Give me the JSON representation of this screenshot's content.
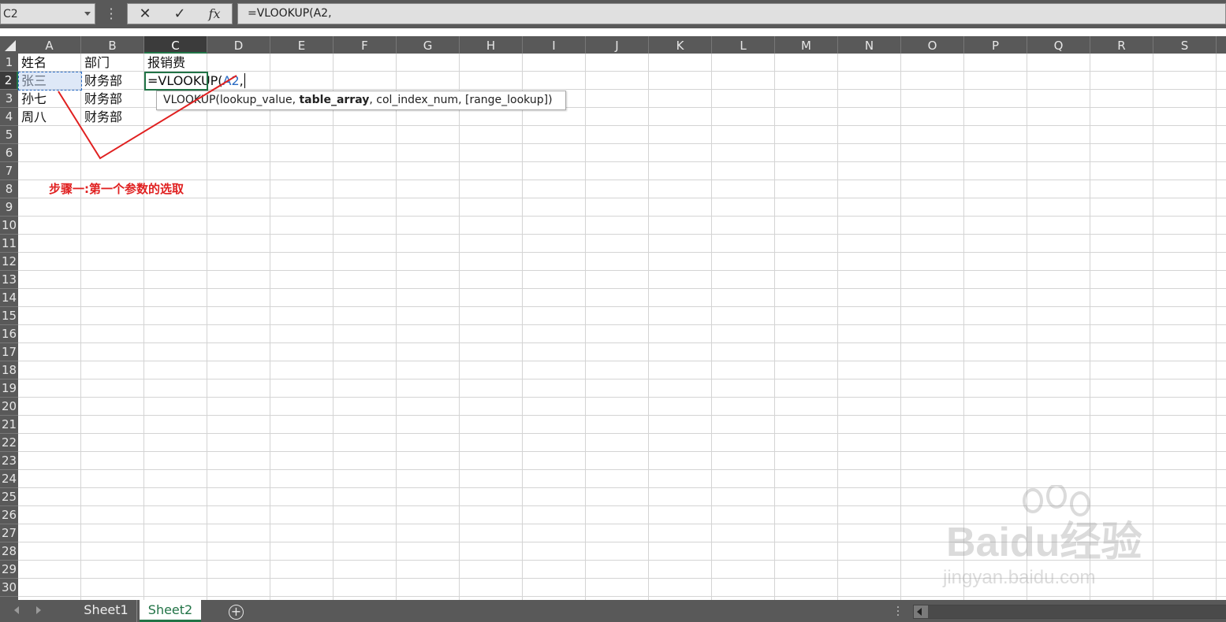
{
  "formula_bar": {
    "name_box": "C2",
    "cancel_glyph": "✕",
    "enter_glyph": "✓",
    "fx_label": "fx",
    "formula": "=VLOOKUP(A2,"
  },
  "columns": [
    "A",
    "B",
    "C",
    "D",
    "E",
    "F",
    "G",
    "H",
    "I",
    "J",
    "K",
    "L",
    "M",
    "N",
    "O",
    "P",
    "Q",
    "R",
    "S"
  ],
  "active_column": "C",
  "rows": [
    "1",
    "2",
    "3",
    "4",
    "5",
    "6",
    "7",
    "8",
    "9",
    "10",
    "11",
    "12",
    "13",
    "14",
    "15",
    "16",
    "17",
    "18",
    "19",
    "20",
    "21",
    "22",
    "23",
    "24",
    "25",
    "26",
    "27",
    "28",
    "29",
    "30"
  ],
  "active_row": "2",
  "cells": {
    "A1": "姓名",
    "B1": "部门",
    "C1": "报销费",
    "A2": "张三",
    "B2": "财务部",
    "C2_prefix": "=VLOOKUP(",
    "C2_ref": "A2",
    "C2_suffix": ",",
    "A3": "孙七",
    "B3": "财务部",
    "A4": "周八",
    "B4": "财务部"
  },
  "tooltip": {
    "prefix": "VLOOKUP(lookup_value, ",
    "bold": "table_array",
    "suffix": ", col_index_num, [range_lookup])"
  },
  "annotation": {
    "text": "步骤一:第一个参数的选取",
    "color": "#e02020"
  },
  "watermark": {
    "line1": "Baidu经验",
    "line2": "jingyan.baidu.com"
  },
  "sheets": [
    {
      "label": "Sheet1",
      "active": false
    },
    {
      "label": "Sheet2",
      "active": true
    }
  ],
  "colors": {
    "accent": "#217346",
    "ref_blue": "#2b6cc4",
    "header_bg": "#595959"
  }
}
